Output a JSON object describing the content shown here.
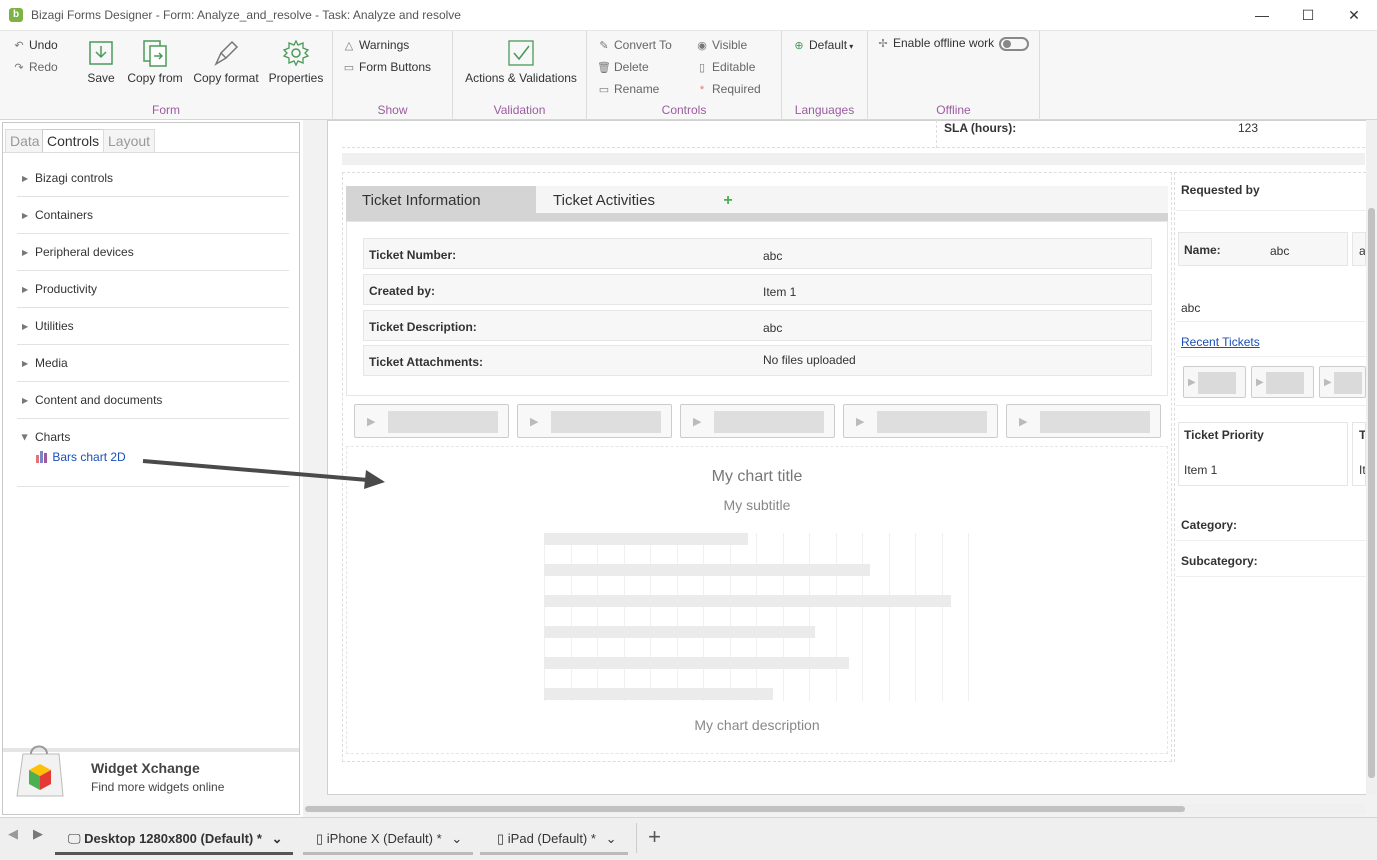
{
  "window": {
    "title": "Bizagi Forms Designer  - Form: Analyze_and_resolve - Task:  Analyze and resolve",
    "app_icon_letter": "b",
    "controls": {
      "minimize": "—",
      "maximize": "☐",
      "close": "✕"
    }
  },
  "ribbon": {
    "undo": "Undo",
    "redo": "Redo",
    "save": "Save",
    "copy_from": "Copy from",
    "copy_format": "Copy format",
    "properties": "Properties",
    "form_group": "Form",
    "warnings": "Warnings",
    "form_buttons": "Form Buttons",
    "show_group": "Show",
    "actions_validations": "Actions & Validations",
    "validation_group": "Validation",
    "convert_to": "Convert To",
    "delete": "Delete",
    "rename": "Rename",
    "visible": "Visible",
    "editable": "Editable",
    "required": "Required",
    "controls_group": "Controls",
    "language_default": "Default",
    "languages_group": "Languages",
    "enable_offline": "Enable offline work",
    "offline_group": "Offline",
    "offline_enabled": false
  },
  "left_panel": {
    "tabs": [
      "Data",
      "Controls",
      "Layout"
    ],
    "active_tab": "Controls",
    "categories": [
      "Bizagi controls",
      "Containers",
      "Peripheral devices",
      "Productivity",
      "Utilities",
      "Media",
      "Content and documents"
    ],
    "charts_label": "Charts",
    "chart_item": "Bars chart 2D",
    "widget_title": "Widget Xchange",
    "widget_sub": "Find more widgets online"
  },
  "form": {
    "sla_label": "SLA (hours):",
    "sla_value": "123",
    "tab_info": "Ticket Information",
    "tab_activities": "Ticket Activities",
    "add_tab": "+",
    "rows": [
      {
        "label": "Ticket Number:",
        "value": "abc"
      },
      {
        "label": "Created by:",
        "value": "Item 1"
      },
      {
        "label": "Ticket Description:",
        "value": "abc"
      },
      {
        "label": "Ticket Attachments:",
        "value": "No files uploaded"
      }
    ],
    "chart_title": "My chart title",
    "chart_subtitle": "My subtitle",
    "chart_description": "My chart description",
    "requested_by": "Requested by",
    "name_label": "Name:",
    "name_value": "abc",
    "name_extra": "a",
    "abc_value": "abc",
    "recent_tickets": "Recent Tickets",
    "ticket_priority": "Ticket Priority",
    "priority_value": "Item 1",
    "t_cut": "T",
    "it_cut": "It",
    "category_label": "Category:",
    "subcategory_label": "Subcategory:"
  },
  "chart_data": {
    "type": "bar",
    "title": "My chart title",
    "subtitle": "My subtitle",
    "description": "My chart description",
    "orientation": "horizontal",
    "categories": [
      "",
      "",
      "",
      "",
      "",
      ""
    ],
    "values": [
      48,
      77,
      96,
      64,
      72,
      54
    ],
    "xlim": [
      0,
      100
    ],
    "grid": true,
    "colors": [
      "#ebebeb"
    ]
  },
  "bottom_tabs": [
    {
      "label": "Desktop 1280x800 (Default)",
      "mark": "*",
      "active": true
    },
    {
      "label": "iPhone X (Default)",
      "mark": "*",
      "active": false
    },
    {
      "label": "iPad (Default)",
      "mark": "*",
      "active": false
    }
  ],
  "nav": {
    "prev": "◀",
    "next": "▶",
    "add": "+"
  },
  "colors": {
    "accent_purple": "#9c5ba1",
    "link_blue": "#1a4fb8",
    "add_green": "#4caf50"
  }
}
